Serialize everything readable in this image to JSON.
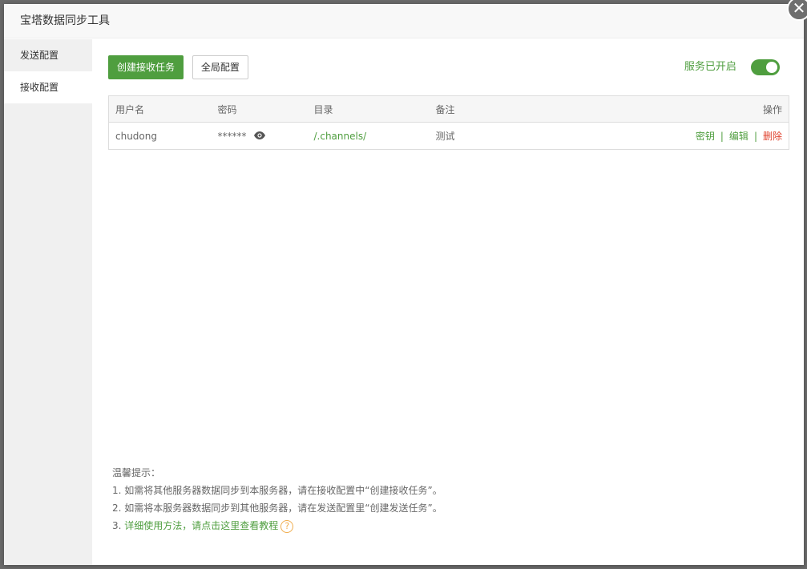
{
  "window": {
    "title": "宝塔数据同步工具",
    "close_glyph": "✕"
  },
  "sidebar": {
    "items": [
      {
        "label": "发送配置"
      },
      {
        "label": "接收配置"
      }
    ]
  },
  "toolbar": {
    "create_label": "创建接收任务",
    "global_label": "全局配置",
    "service_label": "服务已开启",
    "service_on": true
  },
  "table": {
    "headers": {
      "user": "用户名",
      "password": "密码",
      "dir": "目录",
      "remark": "备注",
      "op": "操作"
    },
    "rows": [
      {
        "user": "chudong",
        "password": "******",
        "dir": "/.channels/",
        "remark": "测试",
        "op_key": "密钥",
        "op_edit": "编辑",
        "op_delete": "删除",
        "sep": "|"
      }
    ]
  },
  "tips": {
    "title": "温馨提示：",
    "line1": "1. 如需将其他服务器数据同步到本服务器，请在接收配置中“创建接收任务”。",
    "line2": "2. 如需将本服务器数据同步到其他服务器，请在发送配置里“创建发送任务”。",
    "line3_prefix": "3. ",
    "line3_link": "详细使用方法，请点击这里查看教程",
    "help_glyph": "?"
  },
  "colors": {
    "accent": "#4f9e3f",
    "danger": "#e0432f",
    "help": "#f0ad4e"
  },
  "icons": {
    "eye": "eye-icon",
    "help": "help-circle-icon",
    "close": "close-icon"
  }
}
